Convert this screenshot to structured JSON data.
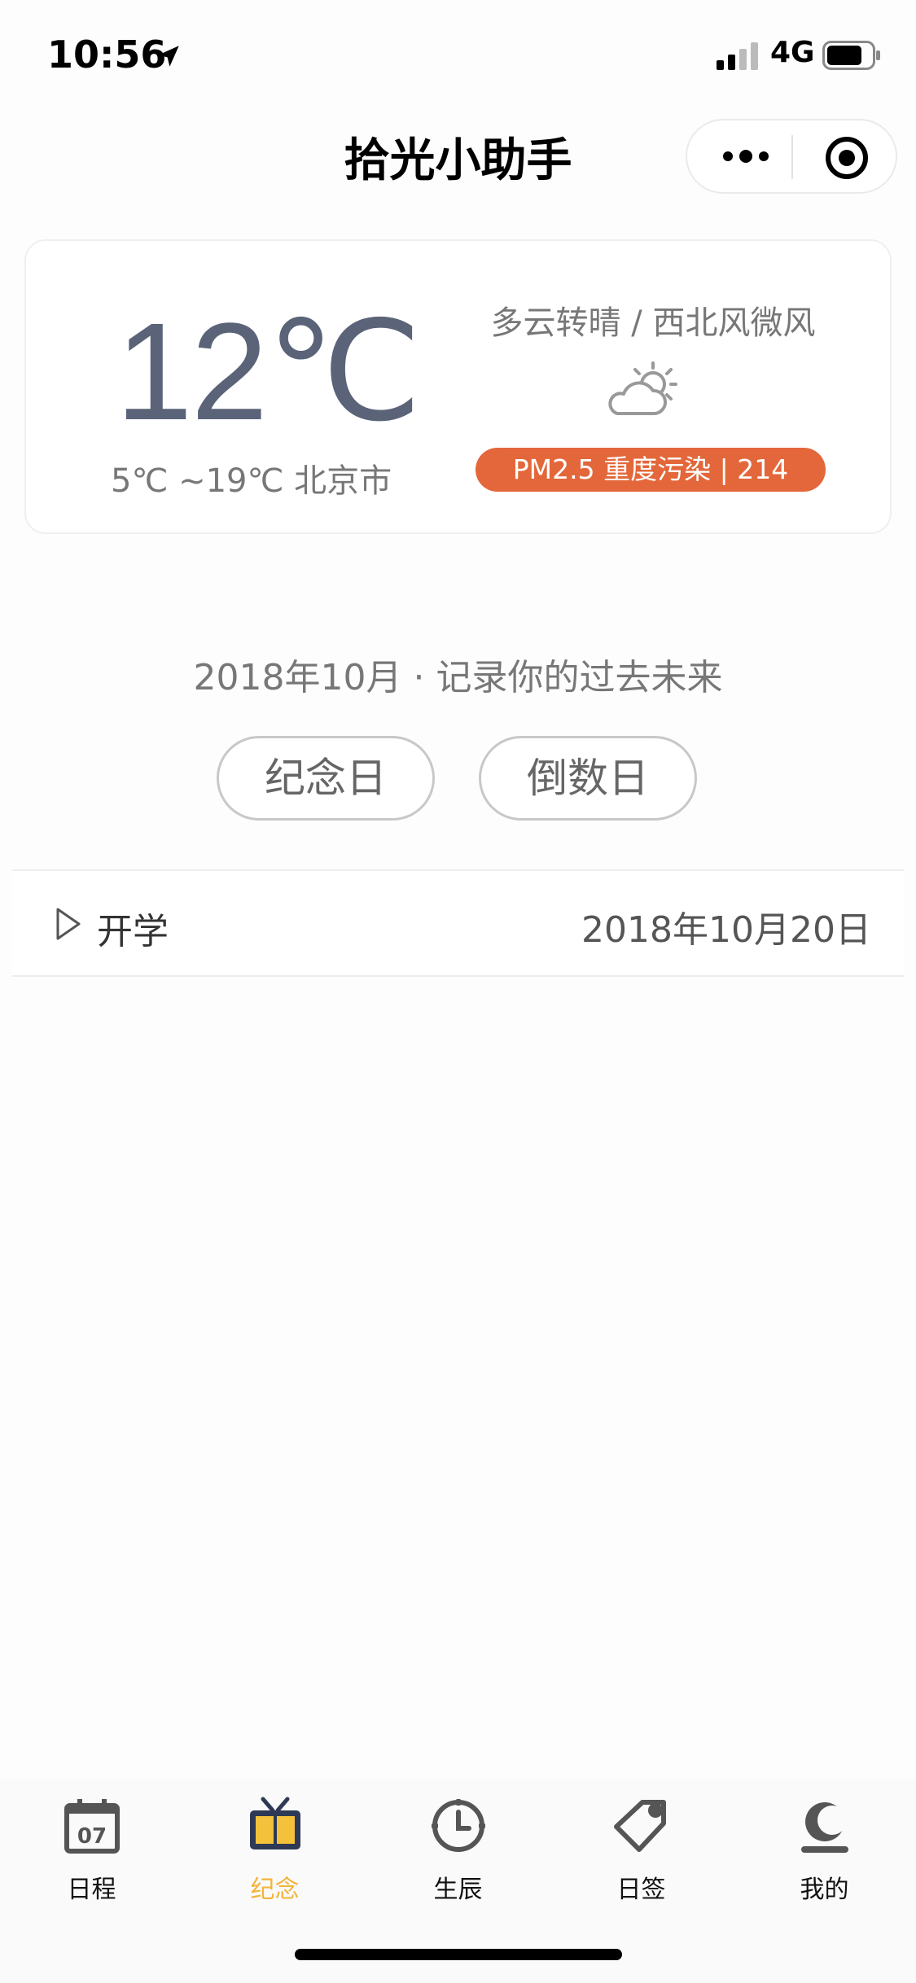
{
  "status_bar": {
    "time": "10:56",
    "network": "4G"
  },
  "nav": {
    "title": "拾光小助手"
  },
  "weather": {
    "temperature": "12℃",
    "range_city": "5℃ ~19℃ 北京市",
    "description": "多云转晴 / 西北风微风",
    "icon": "partly-cloudy-icon",
    "pm_badge": "PM2.5 重度污染 | 214",
    "pm_color": "#e3673a"
  },
  "month_heading": "2018年10月 · 记录你的过去未来",
  "buttons": {
    "anniversary": "纪念日",
    "countdown": "倒数日"
  },
  "list": [
    {
      "title": "开学",
      "date": "2018年10月20日"
    }
  ],
  "tabbar": {
    "accent": "#f3b43a",
    "items": [
      {
        "label": "日程",
        "icon": "calendar-icon",
        "icon_text": "07"
      },
      {
        "label": "纪念",
        "icon": "anniversary-icon",
        "active": true
      },
      {
        "label": "生辰",
        "icon": "clock-icon"
      },
      {
        "label": "日签",
        "icon": "tag-icon"
      },
      {
        "label": "我的",
        "icon": "profile-moon-icon"
      }
    ]
  }
}
